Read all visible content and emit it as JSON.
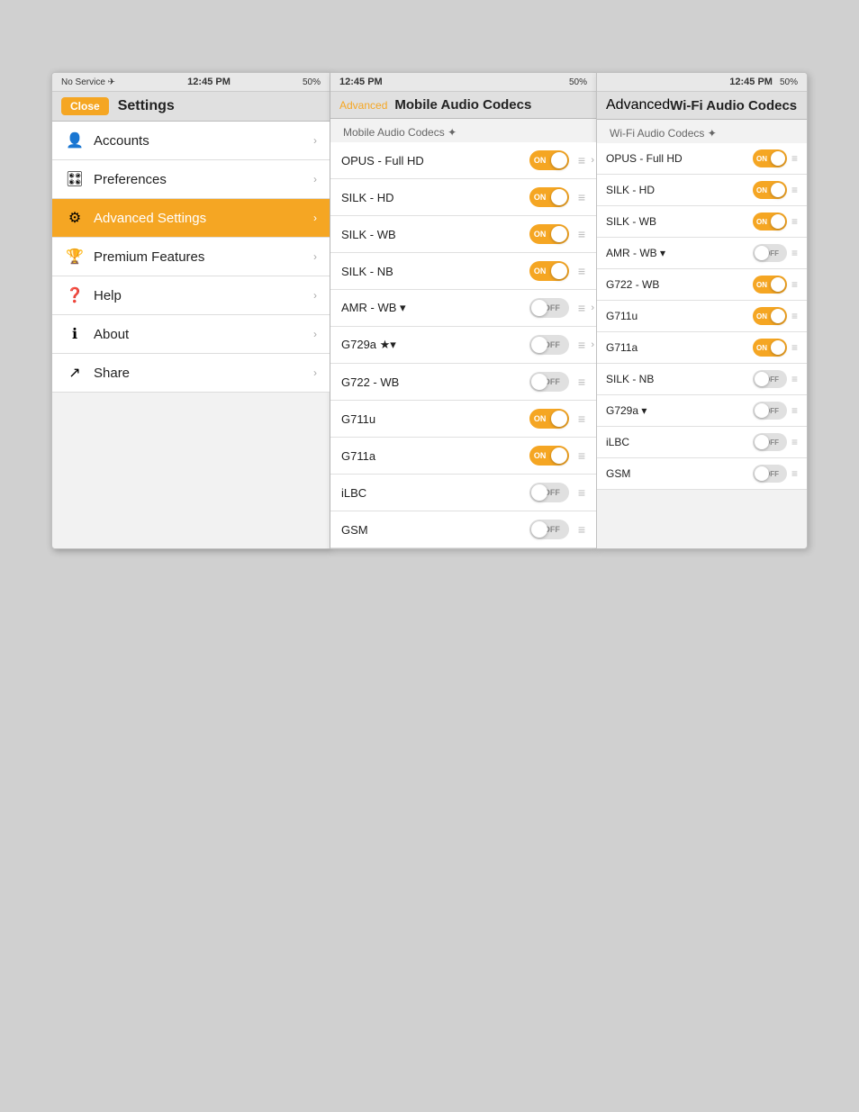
{
  "left_panel": {
    "status_bar": {
      "signal": "No Service ✈",
      "time": "12:45 PM",
      "battery": "50%"
    },
    "nav_bar": {
      "close_label": "Close",
      "title": "Settings"
    },
    "menu_items": [
      {
        "id": "accounts",
        "icon": "👤",
        "label": "Accounts",
        "active": false
      },
      {
        "id": "preferences",
        "icon": "🎛",
        "label": "Preferences",
        "active": false
      },
      {
        "id": "advanced",
        "icon": "⚙",
        "label": "Advanced Settings",
        "active": true
      },
      {
        "id": "premium",
        "icon": "🏆",
        "label": "Premium Features",
        "active": false
      },
      {
        "id": "help",
        "icon": "❓",
        "label": "Help",
        "active": false
      },
      {
        "id": "about",
        "icon": "ℹ",
        "label": "About",
        "active": false
      },
      {
        "id": "share",
        "icon": "↗",
        "label": "Share",
        "active": false
      }
    ]
  },
  "mobile_panel": {
    "status_bar": {
      "time": "12:45 PM",
      "battery": "50%"
    },
    "nav_bar": {
      "back_label": "Advanced",
      "title": "Mobile Audio Codecs"
    },
    "section_header": "Mobile Audio Codecs ✦",
    "codecs": [
      {
        "name": "OPUS - Full HD",
        "state": "on",
        "has_chevron": true
      },
      {
        "name": "SILK - HD",
        "state": "on",
        "has_chevron": false
      },
      {
        "name": "SILK - WB",
        "state": "on",
        "has_chevron": false
      },
      {
        "name": "SILK - NB",
        "state": "on",
        "has_chevron": false
      },
      {
        "name": "AMR - WB ▾",
        "state": "off",
        "has_chevron": true
      },
      {
        "name": "G729a ★▾",
        "state": "off",
        "has_chevron": true
      },
      {
        "name": "G722 - WB",
        "state": "off",
        "has_chevron": false
      },
      {
        "name": "G711u",
        "state": "on",
        "has_chevron": false
      },
      {
        "name": "G711a",
        "state": "on",
        "has_chevron": false
      },
      {
        "name": "iLBC",
        "state": "off",
        "has_chevron": false
      },
      {
        "name": "GSM",
        "state": "off",
        "has_chevron": false
      }
    ]
  },
  "wifi_panel": {
    "status_bar": {
      "time": "12:45 PM",
      "battery": "50%"
    },
    "nav_bar": {
      "back_label": "Advanced",
      "title": "Wi-Fi Audio Codecs"
    },
    "section_header": "Wi-Fi Audio Codecs ✦",
    "codecs": [
      {
        "name": "OPUS - Full HD",
        "state": "on"
      },
      {
        "name": "SILK - HD",
        "state": "on"
      },
      {
        "name": "SILK - WB",
        "state": "on"
      },
      {
        "name": "AMR - WB ▾",
        "state": "off"
      },
      {
        "name": "G722 - WB",
        "state": "on"
      },
      {
        "name": "G711u",
        "state": "on"
      },
      {
        "name": "G711a",
        "state": "on"
      },
      {
        "name": "SILK - NB",
        "state": "off"
      },
      {
        "name": "G729a ▾",
        "state": "off"
      },
      {
        "name": "iLBC",
        "state": "off"
      },
      {
        "name": "GSM",
        "state": "off"
      }
    ]
  }
}
